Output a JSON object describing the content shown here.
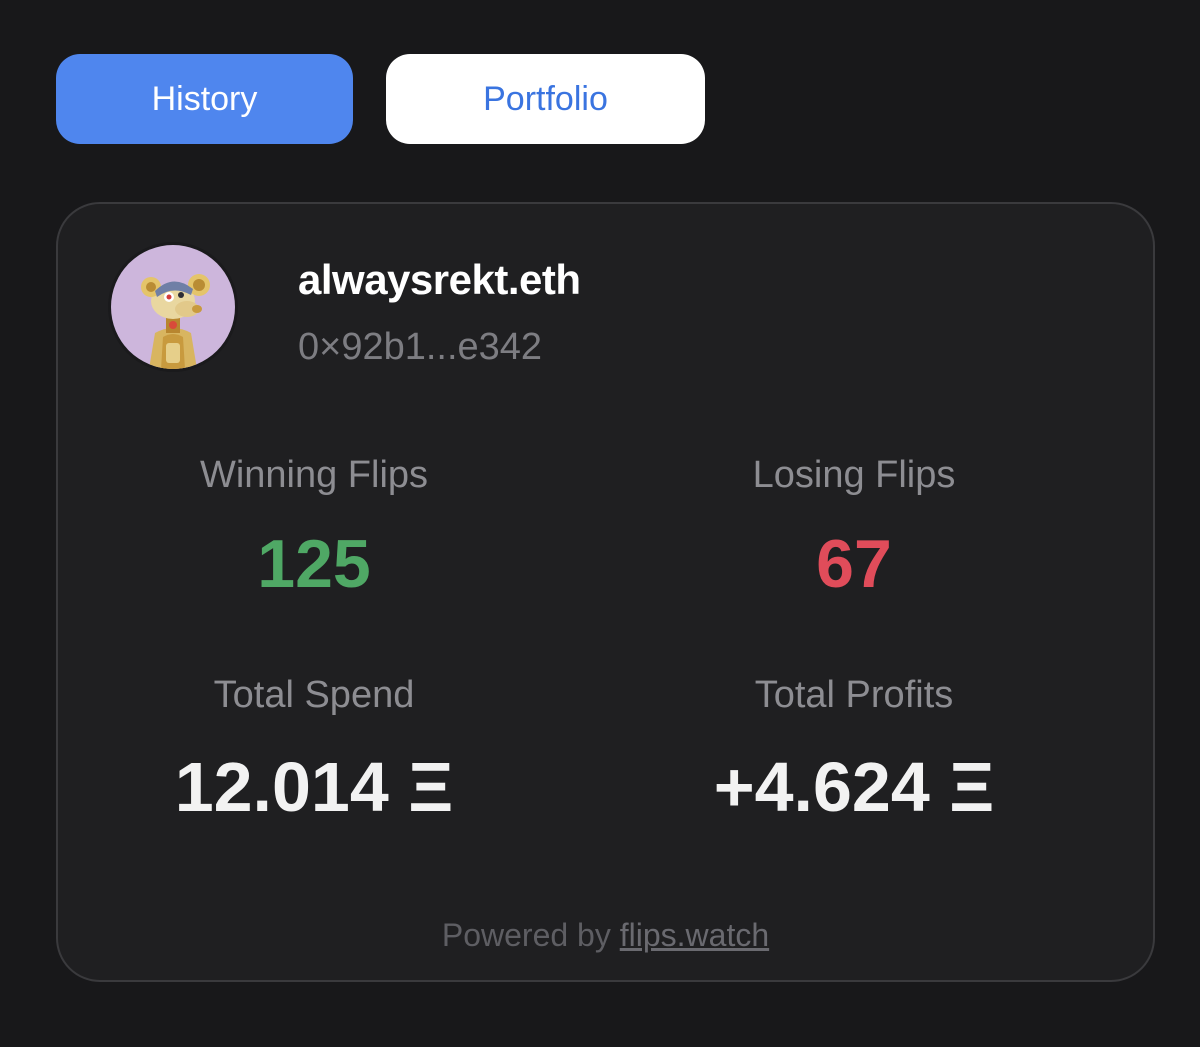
{
  "tabs": {
    "history_label": "History",
    "portfolio_label": "Portfolio"
  },
  "profile": {
    "username": "alwaysrekt.eth",
    "address": "0×92b1...e342",
    "avatar_icon": "nft-avatar-icon"
  },
  "stats": {
    "winning_label": "Winning Flips",
    "winning_value": "125",
    "losing_label": "Losing Flips",
    "losing_value": "67",
    "spend_label": "Total Spend",
    "spend_value": "12.014 Ξ",
    "profits_label": "Total Profits",
    "profits_value": "+4.624 Ξ"
  },
  "footer": {
    "prefix": "Powered by ",
    "link": "flips.watch"
  },
  "colors": {
    "background": "#18181a",
    "card": "#1f1f21",
    "accent_blue": "#4f86ee",
    "win_green": "#4fa865",
    "lose_red": "#e04c5a"
  }
}
